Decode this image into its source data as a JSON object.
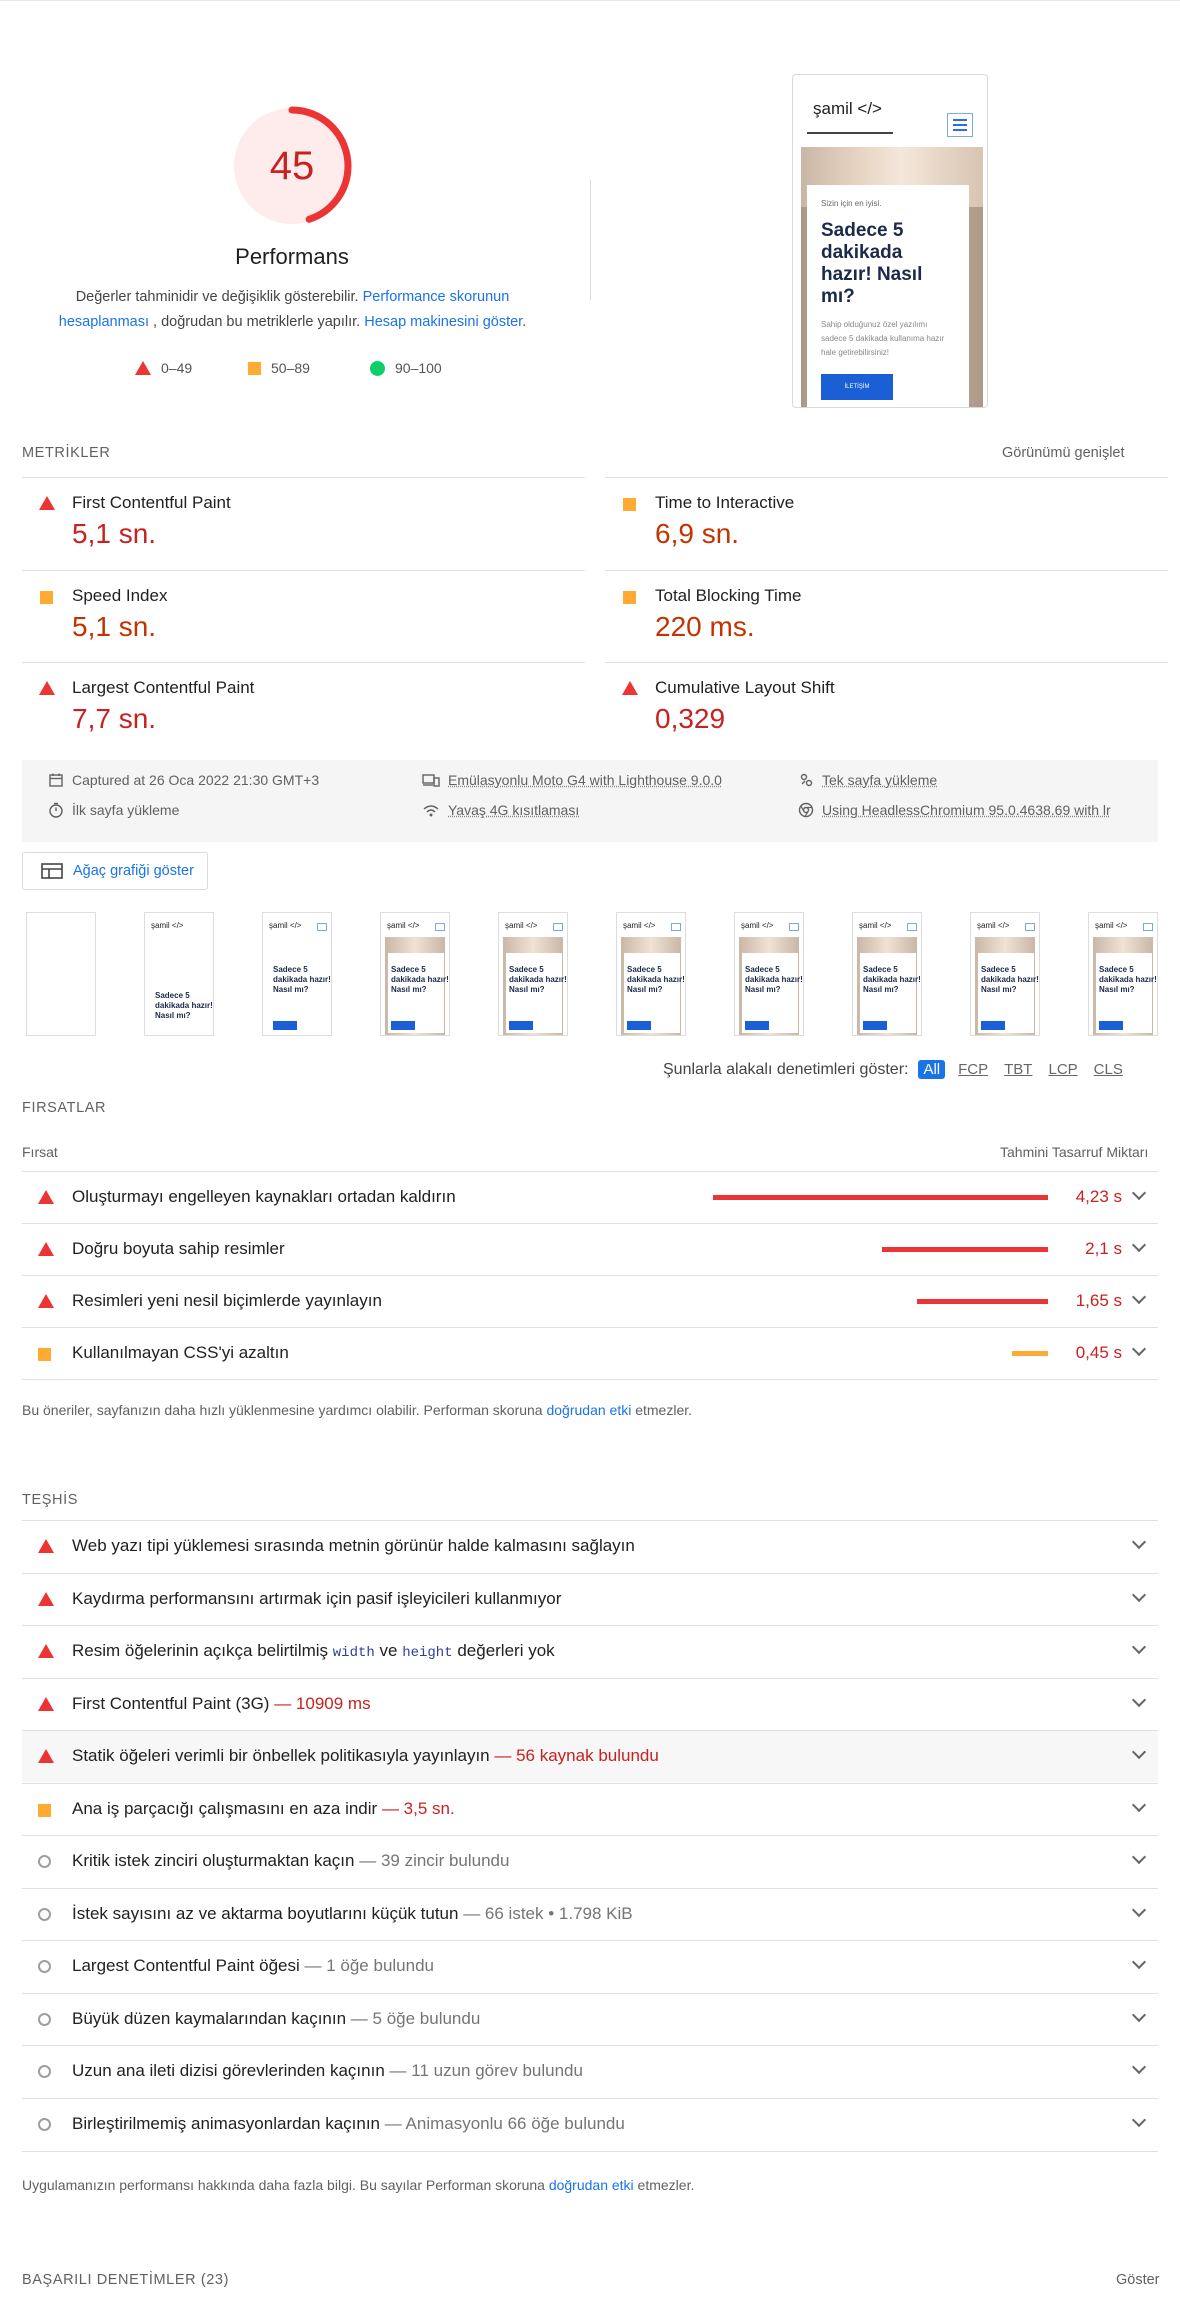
{
  "score": {
    "value": "45",
    "fraction": 0.45,
    "title": "Performans"
  },
  "description": {
    "pre": "Değerler tahminidir ve değişiklik gösterebilir. ",
    "link1": "Performance skorunun hesaplanması",
    "mid": " , doğrudan bu metriklerle yapılır. ",
    "link2": "Hesap makinesini göster",
    "post": "."
  },
  "legend": [
    {
      "label": "0–49"
    },
    {
      "label": "50–89"
    },
    {
      "label": "90–100"
    }
  ],
  "preview": {
    "brand": "şamil </>",
    "small": "Sizin için en iyisi.",
    "headline": "Sadece 5 dakikada hazır! Nasıl mı?",
    "body": "Sahip olduğunuz özel yazılımı sadece 5 dakikada kullanıma hazır hale getirebilirsiniz!",
    "button": "İLETİŞİM"
  },
  "metrics": {
    "label": "METRİKLER",
    "expand": "Görünümü genişlet",
    "items": [
      {
        "name": "First Contentful Paint",
        "value": "5,1 sn.",
        "status": "fail"
      },
      {
        "name": "Time to Interactive",
        "value": "6,9 sn.",
        "status": "average"
      },
      {
        "name": "Speed Index",
        "value": "5,1 sn.",
        "status": "average"
      },
      {
        "name": "Total Blocking Time",
        "value": "220 ms.",
        "status": "average"
      },
      {
        "name": "Largest Contentful Paint",
        "value": "7,7 sn.",
        "status": "fail"
      },
      {
        "name": "Cumulative Layout Shift",
        "value": "0,329",
        "status": "fail"
      }
    ]
  },
  "runinfo": {
    "captured": "Captured at 26 Oca 2022 21:30 GMT+3",
    "initial": "İlk sayfa yükleme",
    "emulation": "Emülasyonlu Moto G4 with Lighthouse 9.0.0",
    "throttle": "Yavaş 4G kısıtlaması",
    "single": "Tek sayfa yükleme",
    "browser": "Using HeadlessChromium 95.0.4638.69 with lr"
  },
  "treemap": {
    "label": "Ağaç grafiği göster"
  },
  "filmstrip": {
    "brand": "şamil </>",
    "headline": "Sadece 5 dakikada hazır! Nasıl mı?"
  },
  "filter": {
    "label": "Şunlarla alakalı denetimleri göster:",
    "chips": [
      "All",
      "FCP",
      "TBT",
      "LCP",
      "CLS"
    ]
  },
  "opportunities": {
    "label": "FIRSATLAR",
    "col_left": "Fırsat",
    "col_right": "Tahmini Tasarruf Miktarı",
    "items": [
      {
        "title": "Oluşturmayı engelleyen kaynakları ortadan kaldırın",
        "savings": "4,23 s",
        "seconds": 4.23,
        "status": "fail"
      },
      {
        "title": "Doğru boyuta sahip resimler",
        "savings": "2,1 s",
        "seconds": 2.1,
        "status": "fail"
      },
      {
        "title": "Resimleri yeni nesil biçimlerde yayınlayın",
        "savings": "1,65 s",
        "seconds": 1.65,
        "status": "fail"
      },
      {
        "title": "Kullanılmayan CSS'yi azaltın",
        "savings": "0,45 s",
        "seconds": 0.45,
        "status": "average"
      }
    ],
    "note_pre": "Bu öneriler, sayfanızın daha hızlı yüklenmesine yardımcı olabilir. Performan skoruna ",
    "note_link": "doğrudan etki",
    "note_post": " etmezler."
  },
  "diagnostics": {
    "label": "TEŞHİS",
    "items": [
      {
        "title": "Web yazı tipi yüklemesi sırasında metnin görünür halde kalmasını sağlayın",
        "extra": "",
        "status": "fail"
      },
      {
        "title": "Kaydırma performansını artırmak için pasif işleyicileri kullanmıyor",
        "extra": "",
        "status": "fail"
      },
      {
        "title_a": "Resim öğelerinin açıkça belirtilmiş ",
        "code1": "width",
        "title_b": " ve ",
        "code2": "height",
        "title_c": " değerleri yok",
        "status": "fail"
      },
      {
        "title": "First Contentful Paint (3G)",
        "extra": "— 10909 ms",
        "status": "fail"
      },
      {
        "title": "Statik öğeleri verimli bir önbellek politikasıyla yayınlayın",
        "extra": "— 56 kaynak bulundu",
        "status": "fail"
      },
      {
        "title": "Ana iş parçacığı çalışmasını en aza indir",
        "extra": "— 3,5 sn.",
        "status": "average"
      },
      {
        "title": "Kritik istek zinciri oluşturmaktan kaçın",
        "extra": "— 39 zincir bulundu",
        "status": "info"
      },
      {
        "title": "İstek sayısını az ve aktarma boyutlarını küçük tutun",
        "extra": "— 66 istek • 1.798 KiB",
        "status": "info"
      },
      {
        "title": "Largest Contentful Paint öğesi",
        "extra": "— 1 öğe bulundu",
        "status": "info"
      },
      {
        "title": "Büyük düzen kaymalarından kaçının",
        "extra": "— 5 öğe bulundu",
        "status": "info"
      },
      {
        "title": "Uzun ana ileti dizisi görevlerinden kaçının",
        "extra": "— 11 uzun görev bulundu",
        "status": "info"
      },
      {
        "title": "Birleştirilmemiş animasyonlardan kaçının",
        "extra": "— Animasyonlu 66 öğe bulundu",
        "status": "info"
      }
    ],
    "note_pre": "Uygulamanızın performansı hakkında daha fazla bilgi. Bu sayılar Performan skoruna ",
    "note_link": "doğrudan etki",
    "note_post": " etmezler."
  },
  "passed": {
    "label": "BAŞARILI DENETİMLER",
    "count": "(23)",
    "show": "Göster"
  },
  "colors": {
    "fail": "#eb3434",
    "average": "#ffaa33",
    "pass": "#0cce6b",
    "fail_text": "#c7221f",
    "link": "#1a73e8"
  }
}
